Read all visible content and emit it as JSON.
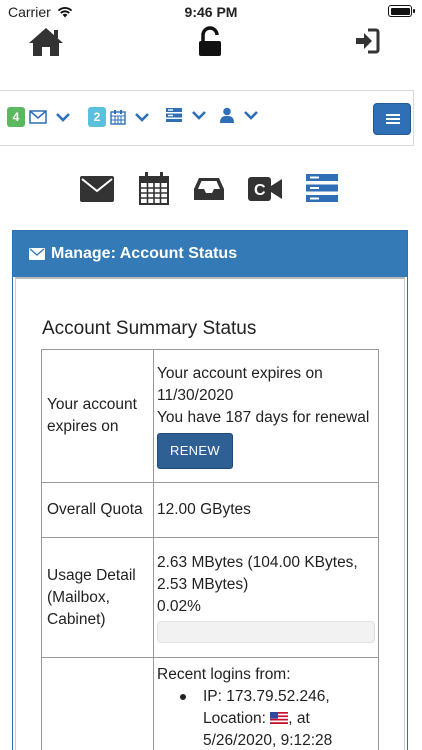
{
  "statusbar": {
    "carrier": "Carrier",
    "time": "9:46 PM"
  },
  "toolbar": {
    "mail_badge": "4",
    "calendar_badge": "2",
    "accent": "#2e6fb5"
  },
  "panel": {
    "title": "Manage: Account Status",
    "summary_title": "Account Summary Status"
  },
  "summary": {
    "expires_label": "Your account expires on",
    "expires_line1": "Your account expires on",
    "expires_date": "11/30/2020",
    "days_line": "You have 187 days for renewal",
    "renew_label": "RENEW",
    "quota_label": "Overall Quota",
    "quota_value": "12.00 GBytes",
    "usage_label": "Usage Detail (Mailbox, Cabinet)",
    "usage_value": "2.63 MBytes (104.00 KBytes, 2.53 MBytes)",
    "usage_percent": "0.02%",
    "usage_fraction": 0.0002,
    "logins_heading": "Recent logins from:",
    "login_1_ip": "IP: 173.79.52.246,",
    "login_1_location": "Location:",
    "login_1_time": ", at",
    "login_1_date": "5/26/2020, 9:12:28"
  }
}
